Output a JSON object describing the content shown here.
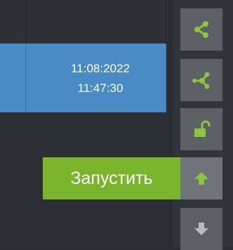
{
  "schedule_cell": {
    "date": "11:08:2022",
    "time": "11:47:30",
    "color": "#4a8ac6"
  },
  "toolbar": {
    "accent_color": "#8cc63f",
    "buttons": [
      {
        "icon": "share-icon",
        "enabled": true
      },
      {
        "icon": "network-icon",
        "enabled": true
      },
      {
        "icon": "unlock-icon",
        "enabled": true
      },
      {
        "icon": "arrow-up-icon",
        "enabled": true
      },
      {
        "icon": "arrow-down-icon",
        "enabled": false
      }
    ],
    "run_tooltip": "Запустить"
  }
}
